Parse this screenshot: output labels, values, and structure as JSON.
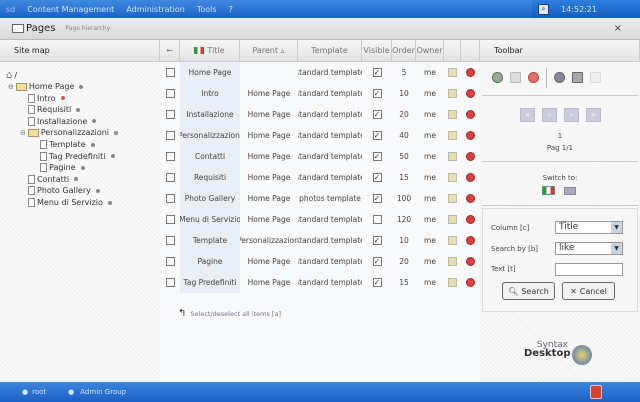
{
  "topbar": {
    "logo": "sd",
    "menu": [
      "Content Management",
      "Administration",
      "Tools",
      "?"
    ],
    "clock": "14:52:21"
  },
  "pagesbar": {
    "title": "Pages",
    "subtitle": "Page hierarchy",
    "close": "×"
  },
  "headers": {
    "sitemap": "Site map",
    "title": "Title",
    "parent": "Parent ▵",
    "template": "Template",
    "visible": "Visible",
    "order": "Order",
    "owner": "Owner",
    "toolbar": "Toolbar"
  },
  "tree": {
    "root": "/",
    "nodes": [
      {
        "label": "Home Page",
        "type": "folder",
        "level": 0
      },
      {
        "label": "Intro",
        "type": "doc",
        "level": 1,
        "status": "red"
      },
      {
        "label": "Requisiti",
        "type": "doc",
        "level": 1
      },
      {
        "label": "Installazione",
        "type": "doc",
        "level": 1
      },
      {
        "label": "Personalizzazioni",
        "type": "folder",
        "level": 1
      },
      {
        "label": "Template",
        "type": "doc",
        "level": 2
      },
      {
        "label": "Tag Predefiniti",
        "type": "doc",
        "level": 2
      },
      {
        "label": "Pagine",
        "type": "doc",
        "level": 2
      },
      {
        "label": "Contatti",
        "type": "doc",
        "level": 1
      },
      {
        "label": "Photo Gallery",
        "type": "doc",
        "level": 1
      },
      {
        "label": "Menu di Servizio",
        "type": "doc",
        "level": 1
      }
    ]
  },
  "rows": [
    {
      "title": "Home Page",
      "parent": "",
      "template": "standard template",
      "visible": true,
      "order": "5",
      "owner": "me"
    },
    {
      "title": "Intro",
      "parent": "Home Page",
      "template": "standard template",
      "visible": true,
      "order": "10",
      "owner": "me"
    },
    {
      "title": "Installazione",
      "parent": "Home Page",
      "template": "standard template",
      "visible": true,
      "order": "20",
      "owner": "me"
    },
    {
      "title": "Personalizzazioni",
      "parent": "Home Page",
      "template": "standard template",
      "visible": true,
      "order": "40",
      "owner": "me"
    },
    {
      "title": "Contatti",
      "parent": "Home Page",
      "template": "standard template",
      "visible": true,
      "order": "50",
      "owner": "me"
    },
    {
      "title": "Requisiti",
      "parent": "Home Page",
      "template": "standard template",
      "visible": true,
      "order": "15",
      "owner": "me"
    },
    {
      "title": "Photo Gallery",
      "parent": "Home Page",
      "template": "photos template",
      "visible": true,
      "order": "100",
      "owner": "me"
    },
    {
      "title": "Menu di Servizio",
      "parent": "Home Page",
      "template": "standard template",
      "visible": false,
      "order": "120",
      "owner": "me"
    },
    {
      "title": "Template",
      "parent": "Personalizzazioni",
      "template": "standard template",
      "visible": true,
      "order": "10",
      "owner": "me"
    },
    {
      "title": "Pagine",
      "parent": "Home Page",
      "template": "standard template",
      "visible": true,
      "order": "20",
      "owner": "me"
    },
    {
      "title": "Tag Predefiniti",
      "parent": "Home Page",
      "template": "standard template",
      "visible": true,
      "order": "15",
      "owner": "me"
    }
  ],
  "select_all": "Select/deselect all items [a]",
  "toolbar": {
    "page_number": "1",
    "page_label": "Pag 1/1",
    "switch_to": "Switch to:",
    "column_label": "Column [c]",
    "column_value": "Title",
    "searchby_label": "Search by [b]",
    "searchby_value": "like",
    "text_label": "Text [t]",
    "text_value": "",
    "search": "Search",
    "cancel": "Cancel"
  },
  "brand": {
    "line1": "Syntax",
    "line2": "Desktop"
  },
  "footer": {
    "user": "root",
    "group": "Admin Group"
  }
}
